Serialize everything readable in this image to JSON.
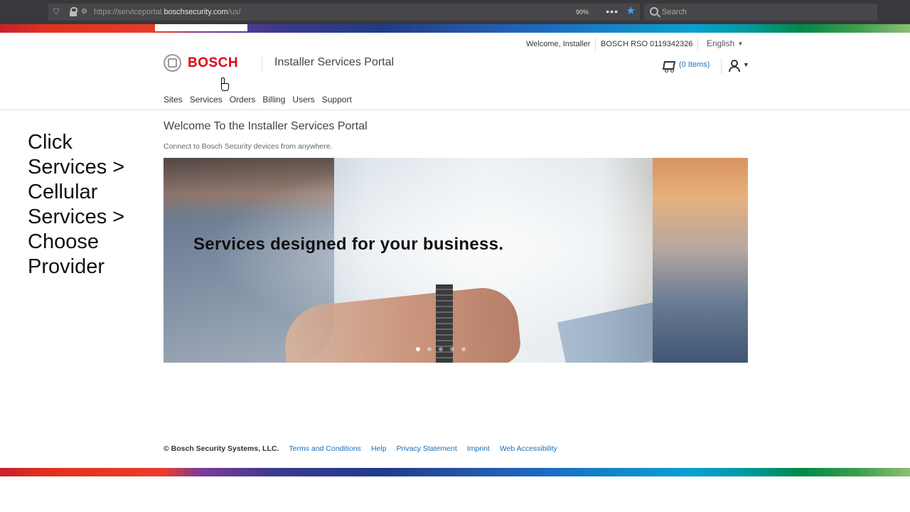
{
  "browser": {
    "url_prefix": "https://serviceportal.",
    "url_host": "boschsecurity.com",
    "url_suffix": "/us/",
    "zoom": "90%",
    "search_placeholder": "Search"
  },
  "header": {
    "welcome": "Welcome, Installer",
    "account": "BOSCH RSO 0119342326",
    "language": "English",
    "logo_text": "BOSCH",
    "portal_title": "Installer Services Portal",
    "cart_count": "(0 Items)"
  },
  "nav": {
    "items": [
      "Sites",
      "Services",
      "Orders",
      "Billing",
      "Users",
      "Support"
    ]
  },
  "instruction": {
    "lines": [
      "Click",
      "Services >",
      "Cellular",
      "Services >",
      "Choose",
      "Provider"
    ]
  },
  "main": {
    "title": "Welcome To the Installer Services Portal",
    "subtitle": "Connect to Bosch Security devices from anywhere.",
    "hero_text": "Services designed for your business.",
    "carousel_active": 1,
    "carousel_total": 5
  },
  "footer": {
    "copyright": "© Bosch Security Systems, LLC.",
    "links": [
      "Terms and Conditions",
      "Help",
      "Privacy Statement",
      "Imprint",
      "Web Accessibility"
    ]
  },
  "colors": {
    "brand_red": "#e20015",
    "link_blue": "#1d6fb8"
  },
  "icons": [
    "shield-icon",
    "lock-icon",
    "permissions-icon",
    "more-icon",
    "bookmark-star-icon",
    "search-icon",
    "bosch-logo-icon",
    "cart-icon",
    "user-icon",
    "caret-down-icon",
    "hand-pointer-cursor"
  ]
}
